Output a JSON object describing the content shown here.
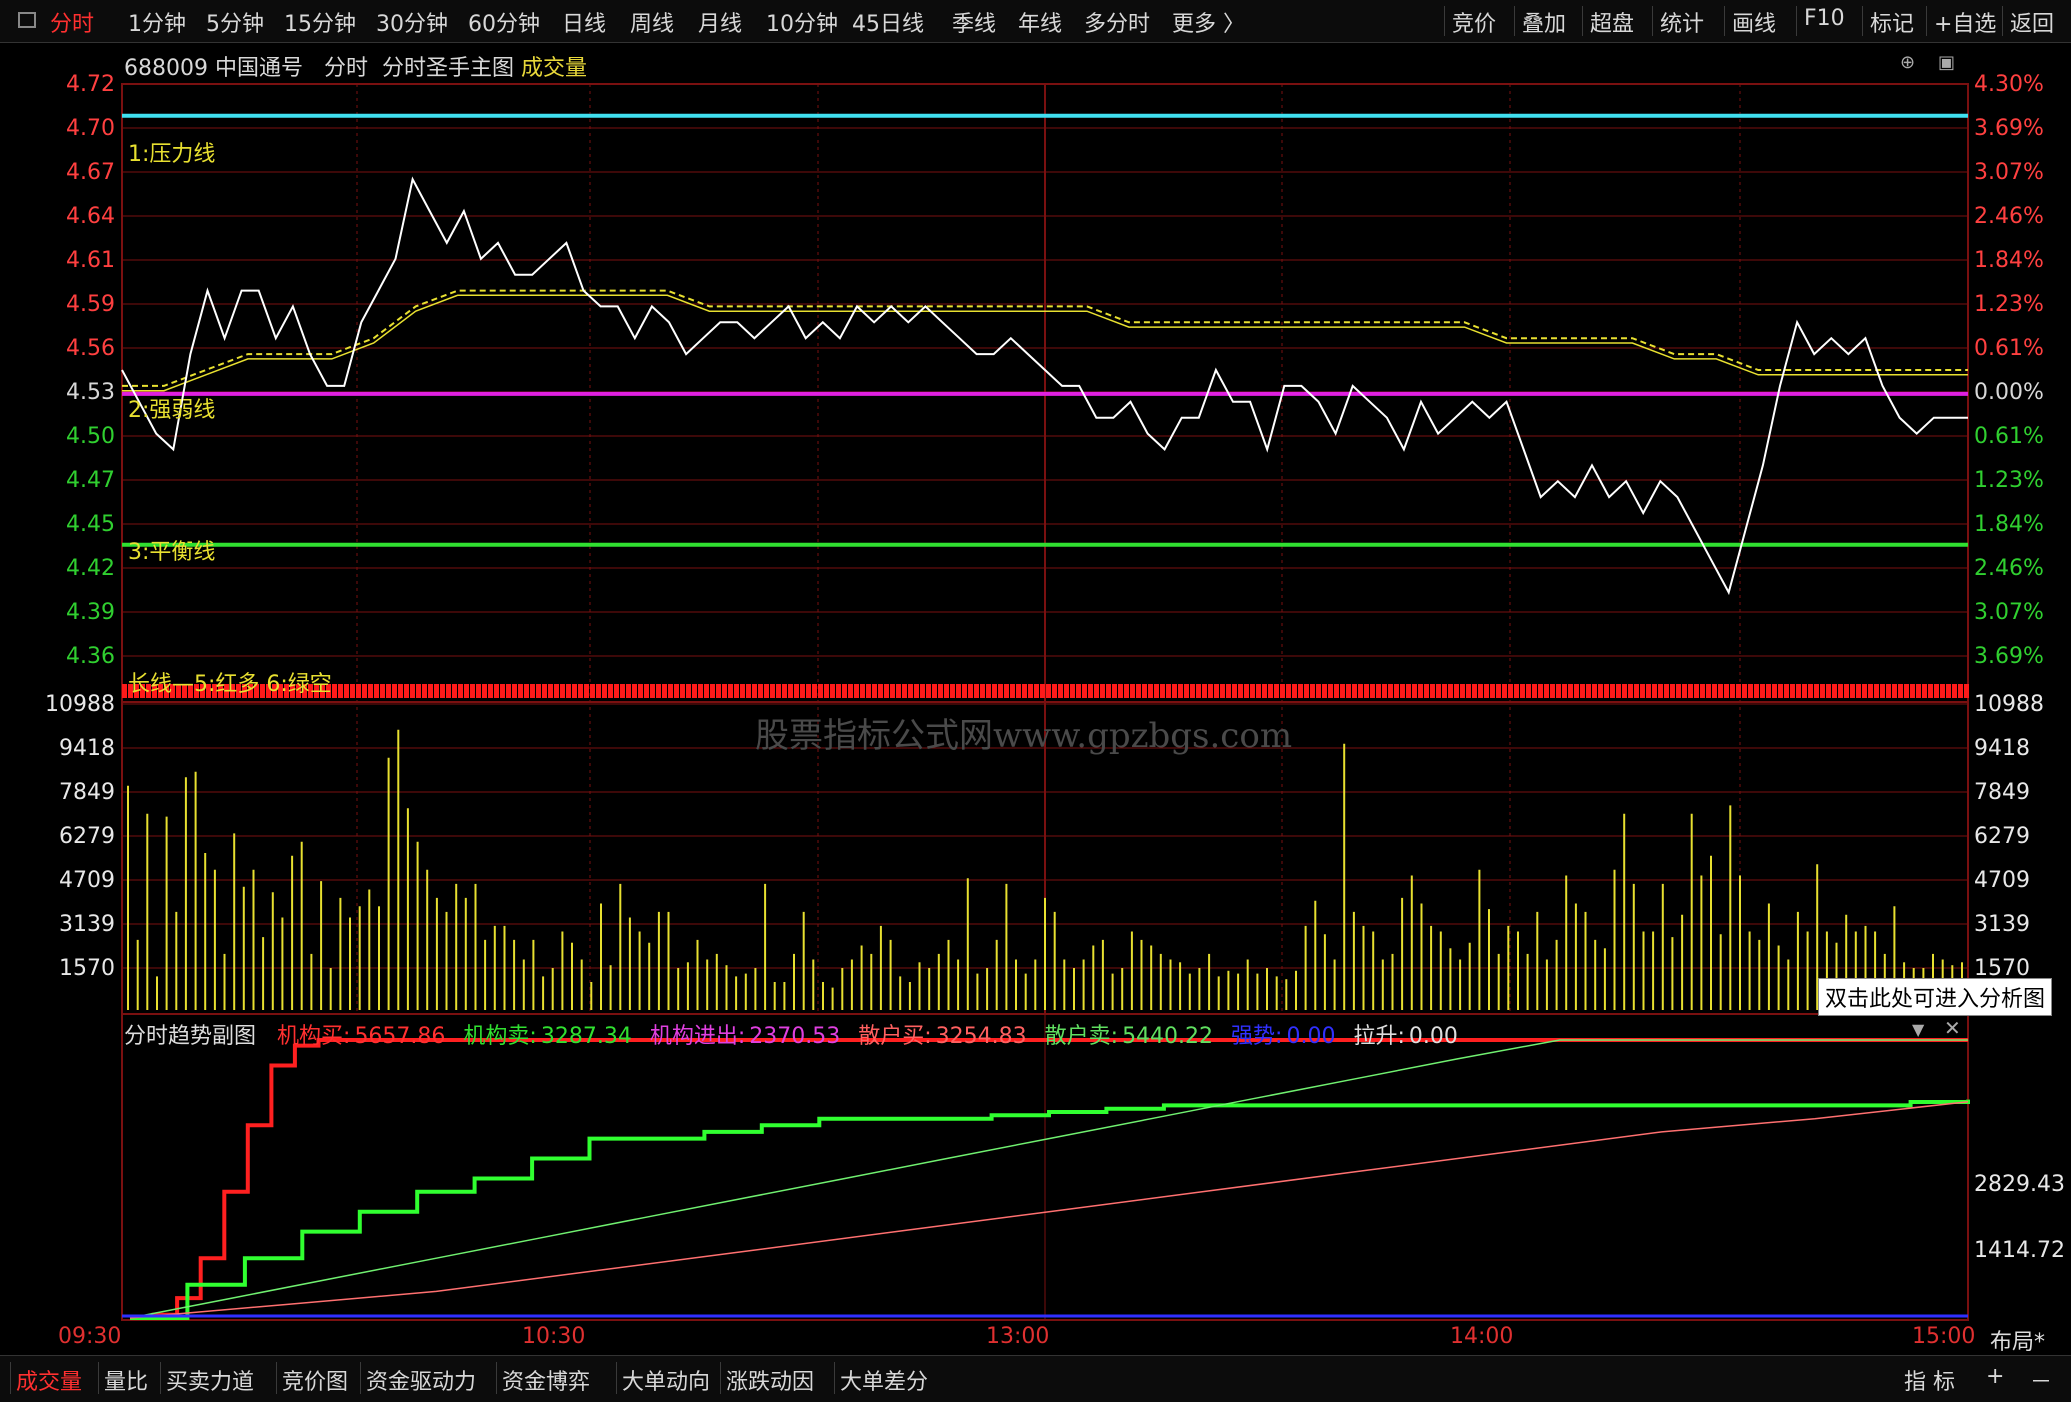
{
  "topbar": {
    "periods": [
      "分时",
      "1分钟",
      "5分钟",
      "15分钟",
      "30分钟",
      "60分钟",
      "日线",
      "周线",
      "月线",
      "10分钟",
      "45日线",
      "季线",
      "年线",
      "多分时",
      "更多 〉"
    ],
    "active_index": 0,
    "tools": [
      "竞价",
      "叠加",
      "超盘",
      "统计",
      "画线",
      "F10",
      "标记",
      "+自选",
      "返回"
    ]
  },
  "header": {
    "code": "688009",
    "name": "中国通号",
    "view": "分时",
    "indicator": "分时圣手主图",
    "volume_label": "成交量"
  },
  "price_axis": {
    "left": [
      "4.72",
      "4.70",
      "4.67",
      "4.64",
      "4.61",
      "4.59",
      "4.56",
      "4.53",
      "4.50",
      "4.47",
      "4.45",
      "4.42",
      "4.39",
      "4.36"
    ],
    "right": [
      "4.30%",
      "3.69%",
      "3.07%",
      "2.46%",
      "1.84%",
      "1.23%",
      "0.61%",
      "0.00%",
      "0.61%",
      "1.23%",
      "1.84%",
      "2.46%",
      "3.07%",
      "3.69%"
    ]
  },
  "volume_axis": {
    "labels": [
      "10988",
      "9418",
      "7849",
      "6279",
      "4709",
      "3139",
      "1570"
    ]
  },
  "sub_axis": {
    "labels": [
      "2829.43",
      "1414.72"
    ]
  },
  "annotations": {
    "pressure": "1:压力线",
    "strong_weak": "2:强弱线",
    "balance": "3:平衡线",
    "long_line": "长线—5:红多   6:绿空"
  },
  "watermark": "股票指标公式网www.gpzbgs.com",
  "subchart": {
    "title": "分时趋势副图",
    "items": [
      {
        "label": "机构买:",
        "value": "5657.86",
        "color": "#ff3030"
      },
      {
        "label": "机构卖:",
        "value": "3287.34",
        "color": "#30e030"
      },
      {
        "label": "机构进出:",
        "value": "2370.53",
        "color": "#e040e0"
      },
      {
        "label": "散户买:",
        "value": "3254.83",
        "color": "#ff6060"
      },
      {
        "label": "散户卖:",
        "value": "5440.22",
        "color": "#60e060"
      },
      {
        "label": "强势:",
        "value": "0.00",
        "color": "#3030ff"
      },
      {
        "label": "拉升:",
        "value": "0.00",
        "color": "#dddddd"
      }
    ]
  },
  "tooltip": "双击此处可进入分析图",
  "time_axis": [
    "09:30",
    "10:30",
    "13:00",
    "14:00",
    "15:00"
  ],
  "bottombar": {
    "tabs": [
      "成交量",
      "量比",
      "买卖力道",
      "竞价图",
      "资金驱动力",
      "资金博弈",
      "大单动向",
      "涨跌动因",
      "大单差分"
    ],
    "active_index": 0,
    "right": [
      "指 标",
      "+",
      "－",
      "布局*"
    ]
  },
  "colors": {
    "price_line": "#ffffff",
    "avg_line": "#e8e030",
    "pressure_line": "#40e0f0",
    "strong_weak_line": "#e020e0",
    "balance_line": "#30e030",
    "grid": "#7a1010",
    "volume": "#e8e030"
  },
  "chart_data": [
    {
      "type": "line",
      "title": "分时圣手主图",
      "ylim": [
        4.36,
        4.72
      ],
      "reference_lines": [
        {
          "name": "1:压力线",
          "value": 4.7
        },
        {
          "name": "2:强弱线",
          "value": 4.525
        },
        {
          "name": "3:平衡线",
          "value": 4.43
        }
      ],
      "series": [
        {
          "name": "price",
          "values": [
            4.54,
            4.52,
            4.5,
            4.49,
            4.55,
            4.59,
            4.56,
            4.59,
            4.59,
            4.56,
            4.58,
            4.55,
            4.53,
            4.53,
            4.57,
            4.59,
            4.61,
            4.66,
            4.64,
            4.62,
            4.64,
            4.61,
            4.62,
            4.6,
            4.6,
            4.61,
            4.62,
            4.59,
            4.58,
            4.58,
            4.56,
            4.58,
            4.57,
            4.55,
            4.56,
            4.57,
            4.57,
            4.56,
            4.57,
            4.58,
            4.56,
            4.57,
            4.56,
            4.58,
            4.57,
            4.58,
            4.57,
            4.58,
            4.57,
            4.56,
            4.55,
            4.55,
            4.56,
            4.55,
            4.54,
            4.53,
            4.53,
            4.51,
            4.51,
            4.52,
            4.5,
            4.49,
            4.51,
            4.51,
            4.54,
            4.52,
            4.52,
            4.49,
            4.53,
            4.53,
            4.52,
            4.5,
            4.53,
            4.52,
            4.51,
            4.49,
            4.52,
            4.5,
            4.51,
            4.52,
            4.51,
            4.52,
            4.49,
            4.46,
            4.47,
            4.46,
            4.48,
            4.46,
            4.47,
            4.45,
            4.47,
            4.46,
            4.44,
            4.42,
            4.4,
            4.44,
            4.48,
            4.53,
            4.57,
            4.55,
            4.56,
            4.55,
            4.56,
            4.53,
            4.51,
            4.5,
            4.51,
            4.51,
            4.51
          ]
        },
        {
          "name": "avg",
          "values": [
            4.53,
            4.53,
            4.54,
            4.55,
            4.55,
            4.55,
            4.56,
            4.58,
            4.59,
            4.59,
            4.59,
            4.59,
            4.59,
            4.59,
            4.58,
            4.58,
            4.58,
            4.58,
            4.58,
            4.58,
            4.58,
            4.58,
            4.58,
            4.58,
            4.57,
            4.57,
            4.57,
            4.57,
            4.57,
            4.57,
            4.57,
            4.57,
            4.57,
            4.56,
            4.56,
            4.56,
            4.56,
            4.55,
            4.55,
            4.54,
            4.54,
            4.54,
            4.54,
            4.54,
            4.54
          ]
        }
      ]
    },
    {
      "type": "bar",
      "title": "成交量",
      "ylim": [
        0,
        10988
      ],
      "series": [
        {
          "name": "成交量",
          "values": [
            8000,
            2500,
            7000,
            1200,
            6900,
            3500,
            8300,
            8500,
            5600,
            5000,
            2000,
            6300,
            4400,
            5000,
            2600,
            4200,
            3300,
            5500,
            6000,
            2000,
            4600,
            1500,
            4000,
            3300,
            3700,
            4300,
            3700,
            9000,
            10000,
            7200,
            6000,
            5000,
            4000,
            3500,
            4500,
            4000,
            4500,
            2500,
            3000,
            3000,
            2500,
            1800,
            2500,
            1200,
            1500,
            2800,
            2400,
            1800,
            1000,
            3800,
            1600,
            4500,
            3300,
            2800,
            2400,
            3500,
            3500,
            1500,
            1700,
            2500,
            1800,
            2000,
            1600,
            1200,
            1300,
            1500,
            4500,
            1000,
            1000,
            2000,
            3500,
            1800,
            1000,
            800,
            1500,
            1800,
            2300,
            2000,
            3000,
            2500,
            1200,
            1000,
            1700,
            1500,
            2000,
            2500,
            1800,
            4700,
            1300,
            1500,
            2500,
            4500,
            1800,
            1300,
            1800,
            4000,
            3500,
            1800,
            1500,
            1800,
            2300,
            2500,
            1300,
            1500,
            2800,
            2500,
            2300,
            2000,
            1800,
            1700,
            1300,
            1500,
            2000,
            1200,
            1400,
            1300,
            1800,
            1300,
            1500,
            1200,
            1100,
            1400,
            3000,
            3900,
            2700,
            1800,
            9500,
            3500,
            3000,
            2800,
            1800,
            2000,
            4000,
            4800,
            3800,
            3000,
            2800,
            2200,
            1800,
            2400,
            5000,
            3600,
            2000,
            3000,
            2800,
            2000,
            3500,
            1800,
            2500,
            4800,
            3800,
            3500,
            2500,
            2200,
            5000,
            7000,
            4500,
            2800,
            2800,
            4500,
            2600,
            3400,
            7000,
            4800,
            5500,
            2700,
            7300,
            4800,
            2800,
            2500,
            3800,
            2300,
            1800,
            3500,
            2800,
            5200,
            2800,
            2400,
            3400,
            2800,
            3000,
            2800,
            2000,
            3700,
            1700,
            1500,
            1500,
            2000,
            1800,
            1600,
            1700
          ]
        }
      ]
    },
    {
      "type": "line",
      "title": "分时趋势副图",
      "ylim": [
        0,
        4244
      ],
      "series": [
        {
          "name": "机构买",
          "values": [
            0,
            50,
            300,
            900,
            1900,
            2900,
            3800,
            4100,
            4650,
            4650,
            4650,
            4650,
            4650,
            4650,
            4650,
            4650,
            4650,
            4650,
            4650,
            4650,
            4650,
            4650,
            4650,
            4650,
            4650,
            4650,
            4650,
            4650,
            4650,
            4650,
            4650,
            4650,
            4650,
            4650,
            4650,
            4650,
            4650,
            4650,
            4650,
            4650,
            4650,
            4650,
            4650,
            4650,
            4650,
            4650,
            4650,
            4650,
            4650,
            4650,
            4650,
            4650,
            4650,
            4650,
            4650,
            4650,
            4650,
            4650,
            4650,
            4650,
            4650,
            4650,
            4650,
            4650,
            4650,
            4650,
            4650,
            4650,
            4650,
            4700,
            4700,
            4700,
            4700,
            4700,
            4700,
            5200,
            5200,
            5200,
            5657.86
          ]
        },
        {
          "name": "机构卖",
          "values": [
            0,
            500,
            900,
            1300,
            1600,
            1900,
            2100,
            2400,
            2700,
            2700,
            2800,
            2900,
            3000,
            3000,
            3000,
            3050,
            3100,
            3150,
            3200,
            3200,
            3200,
            3200,
            3200,
            3200,
            3200,
            3200,
            3200,
            3200,
            3200,
            3200,
            3200,
            3250,
            3287.34
          ]
        },
        {
          "name": "散户卖",
          "values": [
            0,
            300,
            600,
            900,
            1200,
            1500,
            1800,
            2100,
            2400,
            2700,
            3000,
            3300,
            3600,
            3900,
            4200,
            4500,
            4800,
            5100,
            5440.22
          ]
        },
        {
          "name": "散户买",
          "values": [
            0,
            200,
            400,
            700,
            1000,
            1300,
            1600,
            1900,
            2200,
            2500,
            2800,
            3000,
            3254.83
          ]
        }
      ]
    }
  ]
}
